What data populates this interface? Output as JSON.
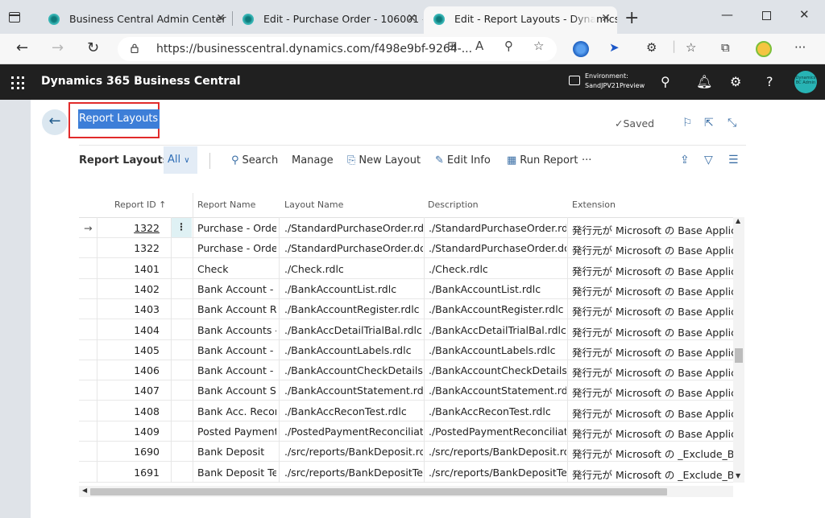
{
  "browser": {
    "tabs": [
      {
        "title": "Business Central Admin Center"
      },
      {
        "title": "Edit - Purchase Order - 106001 -"
      },
      {
        "title": "Edit - Report Layouts - Dynamics"
      }
    ],
    "url": "https://businesscentral.dynamics.com/f498e9bf-9264-..."
  },
  "header": {
    "app_title": "Dynamics 365 Business Central",
    "env_label": "Environment:",
    "env_name": "SandJPV21Preview",
    "avatar_text": "Dynamics BC Admin"
  },
  "page": {
    "title": "Report Layouts",
    "saved_label": "Saved"
  },
  "actionbar": {
    "label": "Report Layouts:",
    "filter": "All",
    "search": "Search",
    "manage": "Manage",
    "new_layout": "New Layout",
    "edit_info": "Edit Info",
    "run_report": "Run Report",
    "more": "···"
  },
  "grid": {
    "columns": [
      "Report ID ↑",
      "Report Name",
      "Layout Name",
      "Description",
      "Extension"
    ],
    "rows": [
      {
        "id": "1322",
        "name": "Purchase - Order",
        "layout": "./StandardPurchaseOrder.rdlc",
        "desc": "./StandardPurchaseOrder.rdlc",
        "ext": "発行元が Microsoft の Base Applica"
      },
      {
        "id": "1322",
        "name": "Purchase - Order",
        "layout": "./StandardPurchaseOrder.docx",
        "desc": "./StandardPurchaseOrder.docx",
        "ext": "発行元が Microsoft の Base Applica"
      },
      {
        "id": "1401",
        "name": "Check",
        "layout": "./Check.rdlc",
        "desc": "./Check.rdlc",
        "ext": "発行元が Microsoft の Base Applica"
      },
      {
        "id": "1402",
        "name": "Bank Account - ...",
        "layout": "./BankAccountList.rdlc",
        "desc": "./BankAccountList.rdlc",
        "ext": "発行元が Microsoft の Base Applica"
      },
      {
        "id": "1403",
        "name": "Bank Account R...",
        "layout": "./BankAccountRegister.rdlc",
        "desc": "./BankAccountRegister.rdlc",
        "ext": "発行元が Microsoft の Base Applica"
      },
      {
        "id": "1404",
        "name": "Bank Accounts -...",
        "layout": "./BankAccDetailTrialBal.rdlc",
        "desc": "./BankAccDetailTrialBal.rdlc",
        "ext": "発行元が Microsoft の Base Applica"
      },
      {
        "id": "1405",
        "name": "Bank Account - ...",
        "layout": "./BankAccountLabels.rdlc",
        "desc": "./BankAccountLabels.rdlc",
        "ext": "発行元が Microsoft の Base Applica"
      },
      {
        "id": "1406",
        "name": "Bank Account - ...",
        "layout": "./BankAccountCheckDetails.r...",
        "desc": "./BankAccountCheckDetails.r...",
        "ext": "発行元が Microsoft の Base Applica"
      },
      {
        "id": "1407",
        "name": "Bank Account St...",
        "layout": "./BankAccountStatement.rdlc",
        "desc": "./BankAccountStatement.rdlc",
        "ext": "発行元が Microsoft の Base Applica"
      },
      {
        "id": "1408",
        "name": "Bank Acc. Recon...",
        "layout": "./BankAccReconTest.rdlc",
        "desc": "./BankAccReconTest.rdlc",
        "ext": "発行元が Microsoft の Base Applica"
      },
      {
        "id": "1409",
        "name": "Posted Payment...",
        "layout": "./PostedPaymentReconciliati...",
        "desc": "./PostedPaymentReconciliati...",
        "ext": "発行元が Microsoft の Base Applica"
      },
      {
        "id": "1690",
        "name": "Bank Deposit",
        "layout": "./src/reports/BankDeposit.rdlc",
        "desc": "./src/reports/BankDeposit.rdlc",
        "ext": "発行元が Microsoft の _Exclude_Ban"
      },
      {
        "id": "1691",
        "name": "Bank Deposit Te...",
        "layout": "./src/reports/BankDepositTes...",
        "desc": "./src/reports/BankDepositTes...",
        "ext": "発行元が Microsoft の _Exclude_Ban"
      }
    ]
  },
  "colors": {
    "header_bg": "#202020",
    "accent": "#3d7ed8",
    "highlight_box": "#e12b2b",
    "selected_cell": "#dff1f4"
  }
}
